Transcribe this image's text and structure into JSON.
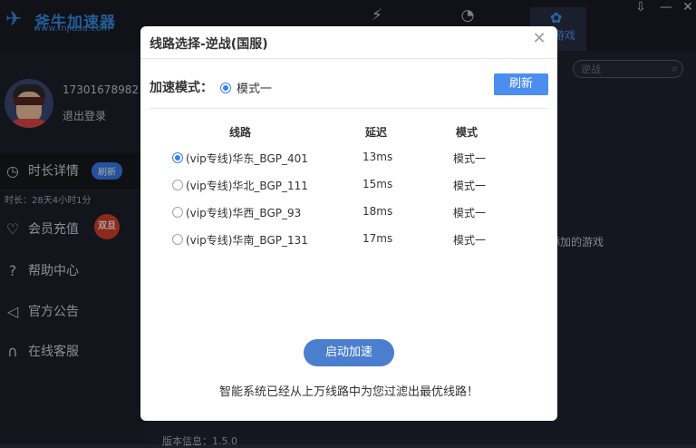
{
  "app": {
    "logo_text": "斧牛加速器",
    "logo_url": "www.fnjiasu.com",
    "active_tab_label": "游戏",
    "search_placeholder": "逆战",
    "empty_hint": "添加的游戏",
    "version": "版本信息：1.5.0"
  },
  "user": {
    "phone": "17301678982",
    "logout": "退出登录"
  },
  "sidebar": {
    "items": [
      {
        "label": "时长详情",
        "icon": "clock-icon"
      },
      {
        "label": "会员充值",
        "icon": "shield-heart-icon"
      },
      {
        "label": "帮助中心",
        "icon": "question-icon"
      },
      {
        "label": "官方公告",
        "icon": "speaker-icon"
      },
      {
        "label": "在线客服",
        "icon": "headset-icon"
      }
    ],
    "refresh_pill": "刷新",
    "duration": "时长：28天4小时1分",
    "badge": "双旦"
  },
  "dialog": {
    "title": "线路选择-逆战(国服)",
    "mode_label": "加速模式：",
    "mode_value": "模式一",
    "refresh": "刷新",
    "columns": [
      "线路",
      "延迟",
      "模式"
    ],
    "rows": [
      {
        "route": "(vip专线)华东_BGP_401",
        "latency": "13ms",
        "mode": "模式一",
        "selected": true
      },
      {
        "route": "(vip专线)华北_BGP_111",
        "latency": "15ms",
        "mode": "模式一",
        "selected": false
      },
      {
        "route": "(vip专线)华西_BGP_93",
        "latency": "18ms",
        "mode": "模式一",
        "selected": false
      },
      {
        "route": "(vip专线)华南_BGP_131",
        "latency": "17ms",
        "mode": "模式一",
        "selected": false
      }
    ],
    "start": "启动加速",
    "footer": "智能系统已经从上万线路中为您过滤出最优线路！"
  }
}
